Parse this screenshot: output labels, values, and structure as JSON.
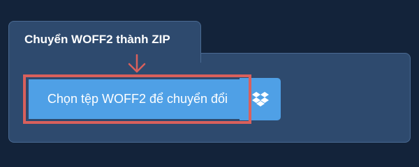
{
  "converter": {
    "tab_title": "Chuyển WOFF2 thành ZIP",
    "upload_label": "Chọn tệp WOFF2 để chuyển đổi",
    "dropbox_icon": "dropbox-icon",
    "arrow_icon": "arrow-down-icon"
  },
  "colors": {
    "background": "#13233a",
    "panel": "#2e4a6e",
    "button": "#4fa0e6",
    "highlight": "#d9605c"
  }
}
